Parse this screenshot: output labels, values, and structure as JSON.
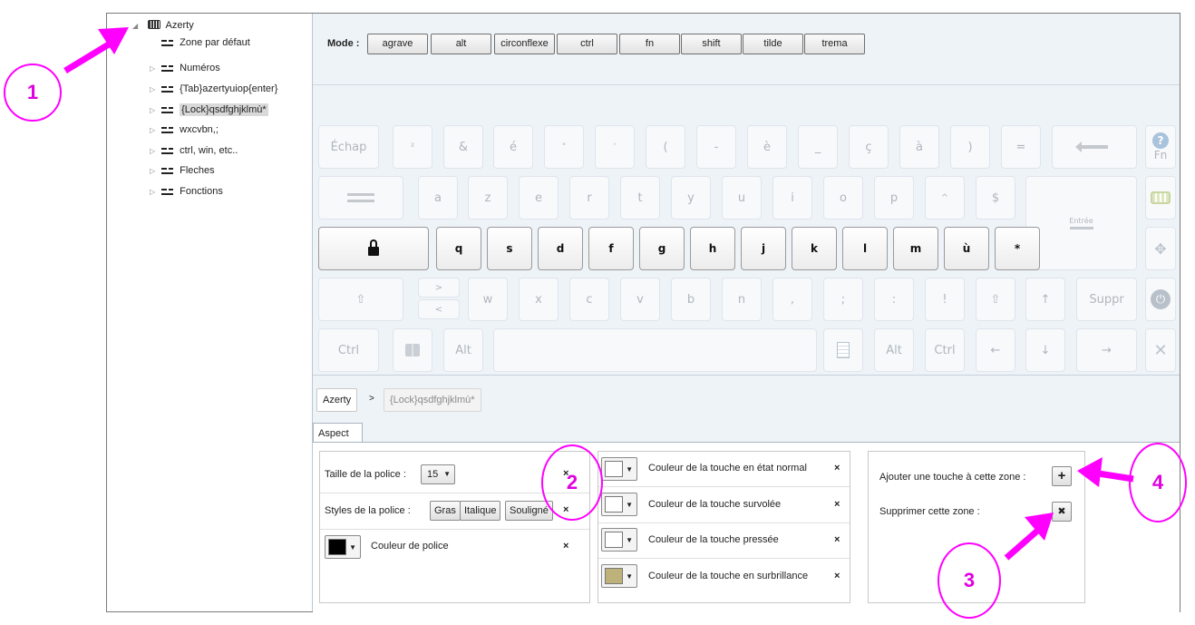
{
  "tree": {
    "root": "Azerty",
    "items": [
      {
        "label": "Zone par défaut",
        "expandable": false
      },
      {
        "label": "Numéros",
        "expandable": true
      },
      {
        "label": "{Tab}azertyuiop{enter}",
        "expandable": true
      },
      {
        "label": "{Lock}qsdfghjklmù*",
        "expandable": true,
        "selected": true
      },
      {
        "label": "wxcvbn,;",
        "expandable": true
      },
      {
        "label": "ctrl, win, etc..",
        "expandable": true
      },
      {
        "label": "Fleches",
        "expandable": true
      },
      {
        "label": "Fonctions",
        "expandable": true
      }
    ]
  },
  "mode": {
    "label": "Mode :",
    "buttons": [
      "agrave",
      "alt",
      "circonflexe",
      "ctrl",
      "fn",
      "shift",
      "tilde",
      "trema"
    ]
  },
  "keyboard": {
    "row1": [
      "Échap",
      "²",
      "&",
      "é",
      "\"",
      "'",
      "(",
      "-",
      "è",
      "_",
      "ç",
      "à",
      ")",
      "="
    ],
    "row2": [
      "a",
      "z",
      "e",
      "r",
      "t",
      "y",
      "u",
      "i",
      "o",
      "p",
      "^",
      "$"
    ],
    "enter_label": "Entrée",
    "row3": [
      "q",
      "s",
      "d",
      "f",
      "g",
      "h",
      "j",
      "k",
      "l",
      "m",
      "ù",
      "*"
    ],
    "row4_angle_top": ">",
    "row4_angle_bottom": "<",
    "row4": [
      "w",
      "x",
      "c",
      "v",
      "b",
      "n",
      ",",
      ";",
      ":",
      "!"
    ],
    "suppr": "Suppr",
    "ctrl_left": "Ctrl",
    "alt_left": "Alt",
    "alt_right": "Alt",
    "ctrl_right": "Ctrl",
    "fn": "Fn",
    "arrow_up": "↑",
    "arrow_down": "↓",
    "arrow_left": "←",
    "arrow_right": "→",
    "shift_glyph": "⇧"
  },
  "breadcrumb": {
    "root": "Azerty",
    "separator": ">",
    "current": "{Lock}qsdfghjklmù*"
  },
  "tabs": {
    "aspect": "Aspect"
  },
  "font_panel": {
    "size_label": "Taille de la police :",
    "size_value": "15",
    "styles_label": "Styles de la police :",
    "styles": [
      "Gras",
      "Italique",
      "Souligné"
    ],
    "color_label": "Couleur de police",
    "color": "#000000"
  },
  "color_panel": {
    "normal": {
      "label": "Couleur de la touche en état normal",
      "color": "#ffffff"
    },
    "hover": {
      "label": "Couleur de la touche survolée",
      "color": "#ffffff"
    },
    "pressed": {
      "label": "Couleur de la touche pressée",
      "color": "#ffffff"
    },
    "highlight": {
      "label": "Couleur de la touche en surbrillance",
      "color": "#bdb37a"
    }
  },
  "zone_panel": {
    "add_label": "Ajouter une touche à cette zone :",
    "add_glyph": "+",
    "delete_label": "Supprimer cette zone :",
    "delete_glyph": "✖"
  },
  "clear_glyph": "×",
  "annotations": [
    "1",
    "2",
    "3",
    "4"
  ],
  "annotation_color": "#ff00ff"
}
